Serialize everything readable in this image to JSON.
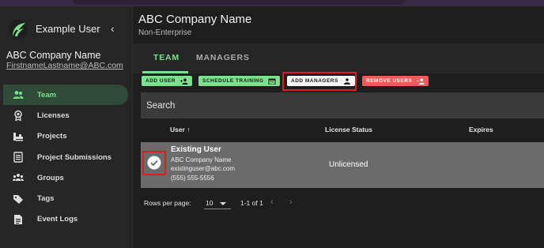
{
  "sidebar": {
    "user_name": "Example User",
    "collapse_icon": "chevron-left-icon",
    "company": "ABC Company Name",
    "email": "FirstnameLastname@ABC.com",
    "items": [
      {
        "label": "Team",
        "icon": "team-icon"
      },
      {
        "label": "Licenses",
        "icon": "license-icon"
      },
      {
        "label": "Projects",
        "icon": "projects-icon"
      },
      {
        "label": "Project Submissions",
        "icon": "submissions-icon"
      },
      {
        "label": "Groups",
        "icon": "groups-icon"
      },
      {
        "label": "Tags",
        "icon": "tags-icon"
      },
      {
        "label": "Event Logs",
        "icon": "event-logs-icon"
      }
    ]
  },
  "header": {
    "title": "ABC Company Name",
    "subtitle": "Non-Enterprise"
  },
  "tabs": [
    {
      "label": "TEAM"
    },
    {
      "label": "MANAGERS"
    }
  ],
  "actions": {
    "add_user": "ADD USER",
    "schedule_training": "SCHEDULE TRAINING",
    "add_managers": "ADD MANAGERS",
    "remove_users": "REMOVE USERS"
  },
  "search": {
    "placeholder": "Search"
  },
  "table": {
    "columns": [
      "User",
      "License Status",
      "Expires"
    ],
    "sort_arrow": "↑",
    "rows": [
      {
        "name": "Existing User",
        "company": "ABC Company Name",
        "email": "existinguser@abc.com",
        "phone": "(555) 555-5556",
        "status": "Unlicensed",
        "expires": ""
      }
    ]
  },
  "pagination": {
    "rows_per_page_label": "Rows per page:",
    "rows_per_page": "10",
    "range": "1-1 of 1",
    "prev": "‹",
    "next": "›"
  },
  "colors": {
    "accent": "#7de08e",
    "danger": "#ef5b5b",
    "highlight": "#e11b22"
  }
}
